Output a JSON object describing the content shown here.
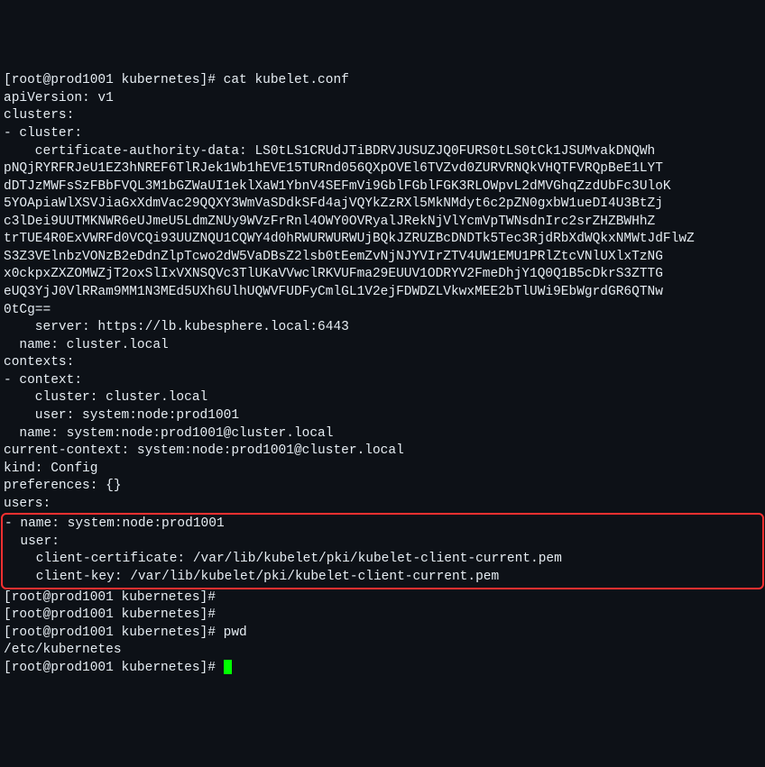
{
  "lines": {
    "l1": "[root@prod1001 kubernetes]# cat kubelet.conf",
    "l2": "apiVersion: v1",
    "l3": "clusters:",
    "l4": "- cluster:",
    "l5": "    certificate-authority-data: LS0tLS1CRUdJTiBDRVJUSUZJQ0FURS0tLS0tCk1JSUMvakDNQWh",
    "l6": "pNQjRYRFRJeU1EZ3hNREF6TlRJek1Wb1hEVE15TURnd056QXpOVEl6TVZvd0ZURVRNQkVHQTFVRQpBeE1LYT",
    "l7": "dDTJzMWFsSzFBbFVQL3M1bGZWaUI1eklXaW1YbnV4SEFmVi9GblFGblFGK3RLOWpvL2dMVGhqZzdUbFc3UloK",
    "l8": "5YOApiaWlXSVJiaGxXdmVac29QQXY3WmVaSDdkSFd4ajVQYkZzRXl5MkNMdyt6c2pZN0gxbW1ueDI4U3BtZj",
    "l9": "c3lDei9UUTMKNWR6eUJmeU5LdmZNUy9WVzFrRnl4OWY0OVRyalJRekNjVlYcmVpTWNsdnIrc2srZHZBWHhZ",
    "l10": "trTUE4R0ExVWRFd0VCQi93UUZNQU1CQWY4d0hRWURWURWUjBQkJZRUZBcDNDTk5Tec3RjdRbXdWQkxNMWtJdFlwZ",
    "l11": "S3Z3VElnbzVONzB2eDdnZlpTcwo2dW5VaDBsZ2lsb0tEemZvNjNJYVIrZTV4UW1EMU1PRlZtcVNlUXlxTzNG",
    "l12": "x0ckpxZXZOMWZjT2oxSlIxVXNSQVc3TlUKaVVwclRKVUFma29EUUV1ODRYV2FmeDhjY1Q0Q1B5cDkrS3ZTTG",
    "l13": "eUQ3YjJ0VlRRam9MM1N3MEd5UXh6UlhUQWVFUDFyCmlGL1V2ejFDWDZLVkwxMEE2bTlUWi9EbWgrdGR6QTNw",
    "l14": "0tCg==",
    "l15": "    server: https://lb.kubesphere.local:6443",
    "l16": "  name: cluster.local",
    "l17": "contexts:",
    "l18": "- context:",
    "l19": "    cluster: cluster.local",
    "l20": "    user: system:node:prod1001",
    "l21": "  name: system:node:prod1001@cluster.local",
    "l22": "current-context: system:node:prod1001@cluster.local",
    "l23": "kind: Config",
    "l24": "preferences: {}",
    "l25": "users:",
    "h1": "- name: system:node:prod1001",
    "h2": "  user:",
    "h3": "    client-certificate: /var/lib/kubelet/pki/kubelet-client-current.pem",
    "h4": "    client-key: /var/lib/kubelet/pki/kubelet-client-current.pem",
    "l26": "[root@prod1001 kubernetes]#",
    "l27": "[root@prod1001 kubernetes]#",
    "l28": "[root@prod1001 kubernetes]# pwd",
    "l29": "/etc/kubernetes",
    "l30": "[root@prod1001 kubernetes]# "
  }
}
